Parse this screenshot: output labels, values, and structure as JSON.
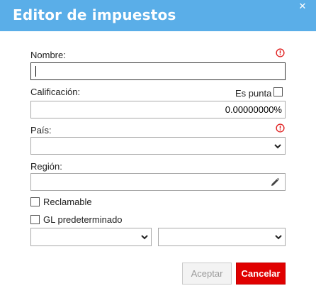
{
  "dialog": {
    "title": "Editor de impuestos"
  },
  "form": {
    "name": {
      "label": "Nombre:",
      "value": ""
    },
    "rating": {
      "label": "Calificación:",
      "value": "0.00000000%",
      "flat_label": "Es punta"
    },
    "country": {
      "label": "País:",
      "value": ""
    },
    "region": {
      "label": "Región:",
      "value": ""
    },
    "claimable": {
      "label": "Reclamable",
      "checked": false
    },
    "default_gl": {
      "label": "GL predeterminado",
      "checked": false
    },
    "gl_select_1": {
      "value": ""
    },
    "gl_select_2": {
      "value": ""
    }
  },
  "buttons": {
    "accept": "Aceptar",
    "cancel": "Cancelar"
  },
  "colors": {
    "header": "#5aaee8",
    "required": "#e02020",
    "cancel": "#e00000"
  }
}
